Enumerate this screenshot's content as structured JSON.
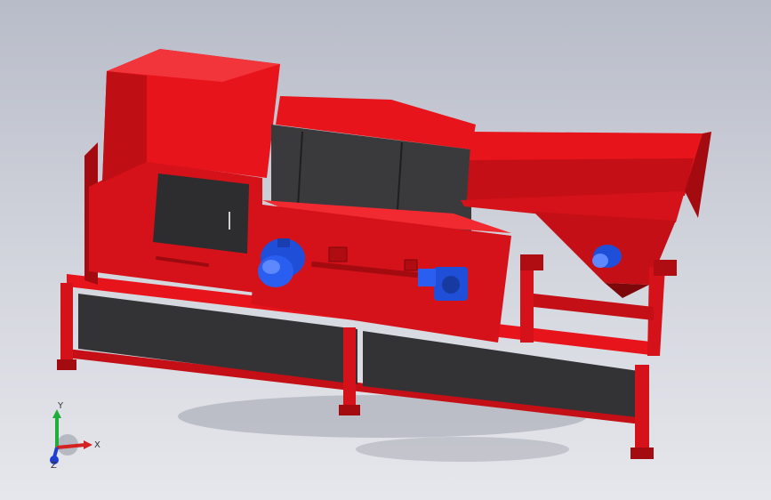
{
  "viewport": {
    "background_top": "#b8bcc8",
    "background_bottom": "#e6e7ec"
  },
  "model": {
    "body_color": "#e8141c",
    "body_dark": "#b00d12",
    "body_shadow": "#7d080c",
    "panel_color": "#2d2d2f",
    "motor_color": "#1f4fd8",
    "motor_highlight": "#5d88ff"
  },
  "triad": {
    "x_label": "X",
    "y_label": "Y",
    "z_label": "Z",
    "x_color": "#d42020",
    "y_color": "#1fae3a",
    "z_color": "#1f3fd0"
  }
}
